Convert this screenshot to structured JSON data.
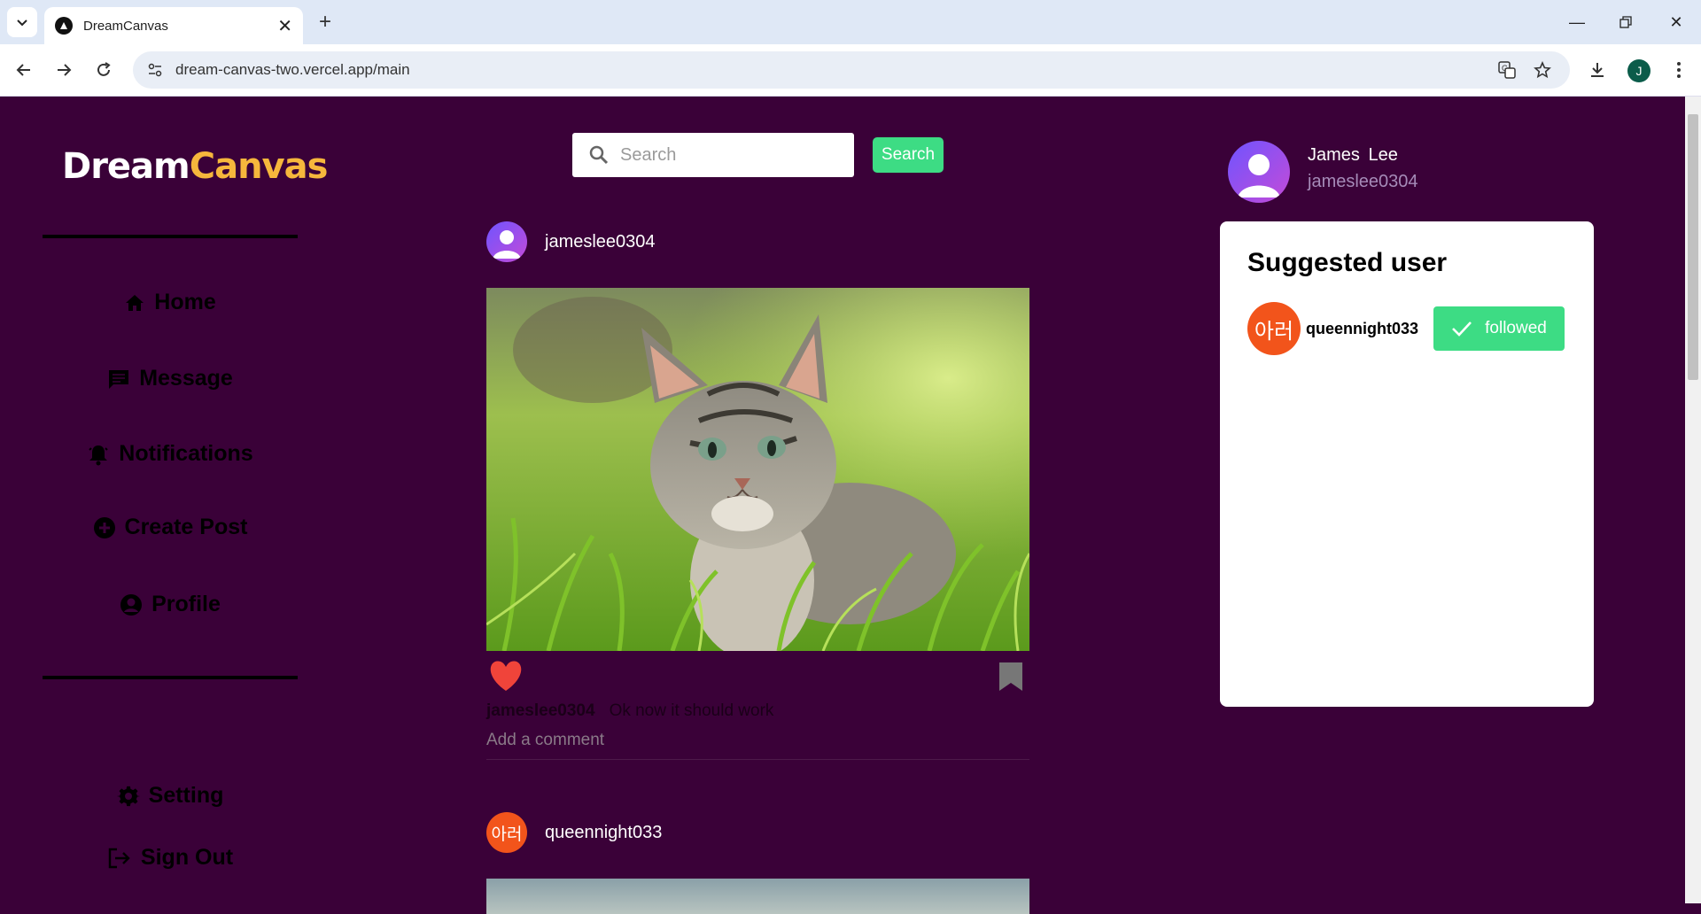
{
  "browser": {
    "tab_title": "DreamCanvas",
    "url": "dream-canvas-two.vercel.app/main",
    "profile_initial": "J"
  },
  "sidebar": {
    "logo_part1": "Dream",
    "logo_part2": "Canvas",
    "items": [
      {
        "label": "Home",
        "icon": "home-icon"
      },
      {
        "label": "Message",
        "icon": "message-icon"
      },
      {
        "label": "Notifications",
        "icon": "bell-icon"
      },
      {
        "label": "Create Post",
        "icon": "plus-circle-icon"
      },
      {
        "label": "Profile",
        "icon": "user-circle-icon"
      }
    ],
    "bottom_items": [
      {
        "label": "Setting",
        "icon": "gear-icon"
      },
      {
        "label": "Sign Out",
        "icon": "sign-out-icon"
      }
    ]
  },
  "search": {
    "placeholder": "Search",
    "button_label": "Search"
  },
  "posts": [
    {
      "username": "jameslee0304",
      "caption_user": "jameslee0304",
      "caption_text": "Ok now it should work",
      "add_comment_placeholder": "Add a comment",
      "liked": true
    },
    {
      "username": "queennight033",
      "avatar_text": "아러"
    }
  ],
  "current_user": {
    "name": "James  Lee",
    "handle": "jameslee0304"
  },
  "suggested": {
    "title": "Suggested user",
    "users": [
      {
        "avatar_text": "아러",
        "username": "queennight033",
        "button_label": "followed"
      }
    ]
  },
  "colors": {
    "page_bg": "#3a0138",
    "accent_green": "#3ddc84",
    "logo_yellow": "#f6b73c",
    "like_red": "#f0443a",
    "korean_avatar": "#f2541b"
  }
}
